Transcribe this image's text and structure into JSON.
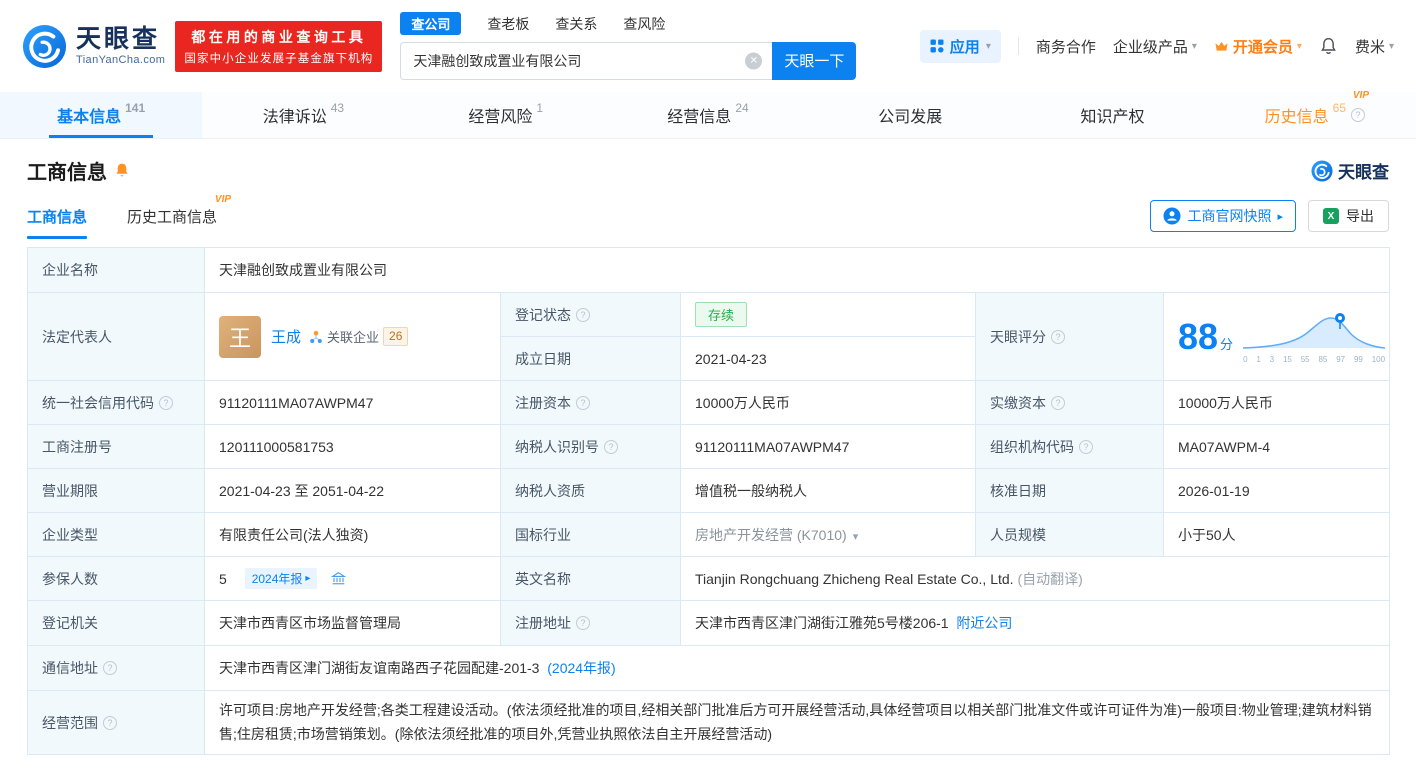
{
  "colors": {
    "primary_blue": "#0b82f0",
    "vip_orange": "#ff9222",
    "status_green": "#23b14d",
    "banner_red": "#e9261f"
  },
  "icons": {
    "clear": "✕",
    "caret_down": "▾",
    "arrow_right": "▸",
    "question_mark": "?",
    "excel": "X"
  },
  "header": {
    "logo_title": "天眼查",
    "logo_subtitle": "TianYanCha.com",
    "slogan_line1": "都在用的商业查询工具",
    "slogan_line2": "国家中小企业发展子基金旗下机构",
    "search_tabs": [
      "查公司",
      "查老板",
      "查关系",
      "查风险"
    ],
    "search_value": "天津融创致成置业有限公司",
    "search_button": "天眼一下",
    "menu_apps": "应用",
    "menu_cooperation": "商务合作",
    "menu_enterprise": "企业级产品",
    "menu_vip": "开通会员",
    "menu_user": "费米"
  },
  "nav_tabs": [
    {
      "label": "基本信息",
      "count": "141"
    },
    {
      "label": "法律诉讼",
      "count": "43"
    },
    {
      "label": "经营风险",
      "count": "1"
    },
    {
      "label": "经营信息",
      "count": "24"
    },
    {
      "label": "公司发展",
      "count": ""
    },
    {
      "label": "知识产权",
      "count": ""
    },
    {
      "label": "历史信息",
      "count": "65"
    }
  ],
  "section": {
    "title": "工商信息",
    "brand": "天眼查",
    "subtab_active": "工商信息",
    "subtab_history": "历史工商信息",
    "vip_tag": "VIP",
    "snapshot_button": "工商官网快照",
    "export_button": "导出"
  },
  "table": {
    "company_name": {
      "label": "企业名称",
      "value": "天津融创致成置业有限公司"
    },
    "legal_rep": {
      "label": "法定代表人",
      "avatar": "王",
      "name": "王成",
      "related_label": "关联企业",
      "related_count": "26"
    },
    "reg_status": {
      "label": "登记状态",
      "value": "存续"
    },
    "establish_date": {
      "label": "成立日期",
      "value": "2021-04-23"
    },
    "score": {
      "label": "天眼评分",
      "value": "88",
      "unit": "分",
      "axis": [
        "0",
        "1",
        "3",
        "15",
        "55",
        "85",
        "97",
        "99",
        "100"
      ]
    },
    "credit_code": {
      "label": "统一社会信用代码",
      "value": "91120111MA07AWPM47"
    },
    "reg_capital": {
      "label": "注册资本",
      "value": "10000万人民币"
    },
    "paid_capital": {
      "label": "实缴资本",
      "value": "10000万人民币"
    },
    "reg_number": {
      "label": "工商注册号",
      "value": "120111000581753"
    },
    "taxpayer_id": {
      "label": "纳税人识别号",
      "value": "91120111MA07AWPM47"
    },
    "org_code": {
      "label": "组织机构代码",
      "value": "MA07AWPM-4"
    },
    "business_term": {
      "label": "营业期限",
      "value": "2021-04-23 至 2051-04-22"
    },
    "taxpayer_quality": {
      "label": "纳税人资质",
      "value": "增值税一般纳税人"
    },
    "approval_date": {
      "label": "核准日期",
      "value": "2026-01-19"
    },
    "company_type": {
      "label": "企业类型",
      "value": "有限责任公司(法人独资)"
    },
    "industry": {
      "label": "国标行业",
      "value": "房地产开发经营 (K7010)"
    },
    "staff_size": {
      "label": "人员规模",
      "value": "小于50人"
    },
    "insured_count": {
      "label": "参保人数",
      "value": "5",
      "badge": "2024年报"
    },
    "english_name": {
      "label": "英文名称",
      "value": "Tianjin Rongchuang Zhicheng Real Estate Co., Ltd.",
      "note": "(自动翻译)"
    },
    "registry": {
      "label": "登记机关",
      "value": "天津市西青区市场监督管理局"
    },
    "reg_address": {
      "label": "注册地址",
      "value": "天津市西青区津门湖街江雅苑5号楼206-1",
      "link": "附近公司"
    },
    "mail_address": {
      "label": "通信地址",
      "value": "天津市西青区津门湖街友谊南路西子花园配建-201-3",
      "link": "(2024年报)"
    },
    "business_scope": {
      "label": "经营范围",
      "value": "许可项目:房地产开发经营;各类工程建设活动。(依法须经批准的项目,经相关部门批准后方可开展经营活动,具体经营项目以相关部门批准文件或许可证件为准)一般项目:物业管理;建筑材料销售;住房租赁;市场营销策划。(除依法须经批准的项目外,凭营业执照依法自主开展经营活动)"
    }
  }
}
